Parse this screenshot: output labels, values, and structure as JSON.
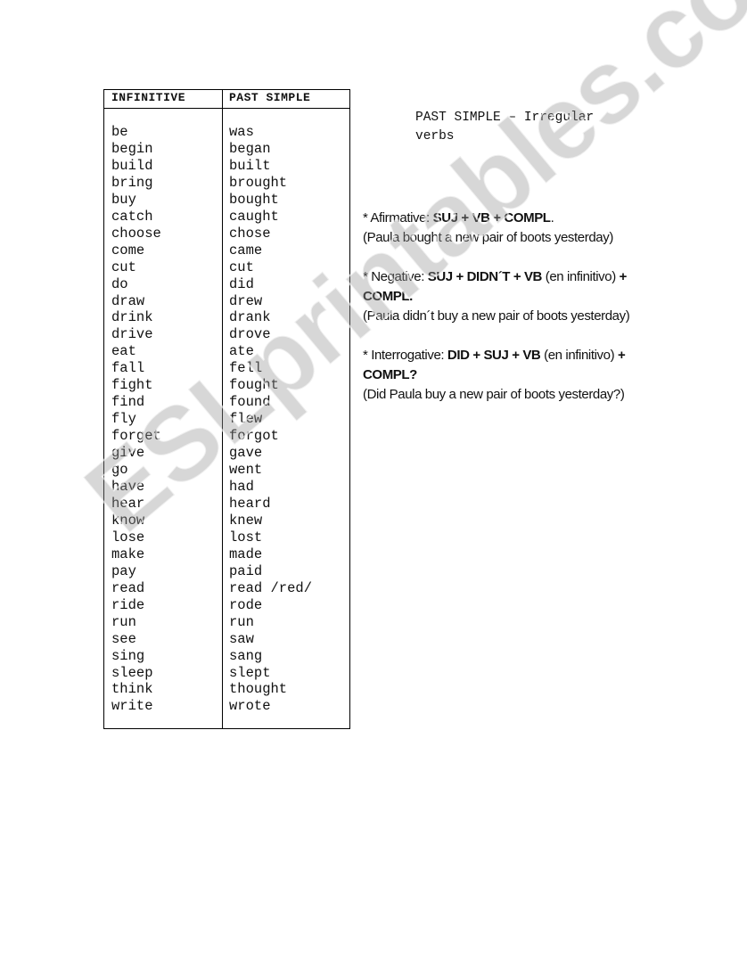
{
  "table": {
    "headers": {
      "infinitive": "INFINITIVE",
      "past_simple": "PAST SIMPLE"
    },
    "infinitive": [
      "be",
      "begin",
      "build",
      "bring",
      "buy",
      "catch",
      "choose",
      "come",
      "cut",
      "do",
      "draw",
      "drink",
      "drive",
      "eat",
      "fall",
      "fight",
      "find",
      "fly",
      "forget",
      "give",
      "go",
      "have",
      "hear",
      "know",
      "lose",
      "make",
      "pay",
      "read",
      "ride",
      "run",
      "see",
      "sing",
      "sleep",
      "think",
      "write"
    ],
    "past_simple": [
      "was",
      "began",
      "built",
      "brought",
      "bought",
      "caught",
      "chose",
      "came",
      "cut",
      "did",
      "drew",
      "drank",
      "drove",
      "ate",
      "fell",
      "fought",
      "found",
      "flew",
      "forgot",
      "gave",
      "went",
      "had",
      "heard",
      "knew",
      "lost",
      "made",
      "paid",
      "read /red/",
      "rode",
      "run",
      "saw",
      "sang",
      "slept",
      "thought",
      "wrote"
    ]
  },
  "title": "PAST SIMPLE – Irregular verbs",
  "rules": [
    {
      "label": "* Afirmative: ",
      "formula_html": "<b>SUJ + VB + COMPL</b>.",
      "example": "(Paula bought a new pair of boots yesterday)"
    },
    {
      "label": "* Negative: ",
      "formula_html": "<b>SUJ + DIDN´T + VB</b> (en infinitivo) <b>+ COMPL.</b>",
      "example": "(Paula didn´t buy a new pair of boots yesterday)"
    },
    {
      "label": "* Interrogative: ",
      "formula_html": "<b>DID + SUJ + VB</b> (en infinitivo) <b>+ COMPL?</b>",
      "example": "(Did Paula buy a new pair of boots yesterday?)"
    }
  ],
  "watermark": "ESLprintables.com"
}
